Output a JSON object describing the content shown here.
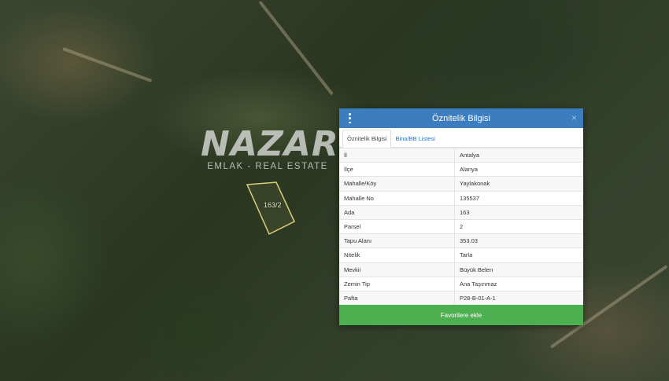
{
  "watermark": {
    "title": "NAZAR",
    "subtitle": "EMLAK - REAL ESTATE"
  },
  "parcel": {
    "label": "163/2"
  },
  "popup": {
    "title": "Öznitelik Bilgisi",
    "tabs": [
      {
        "label": "Öznitelik Bilgisi",
        "active": true
      },
      {
        "label": "Bina/BB Listesi",
        "active": false
      }
    ],
    "rows": [
      {
        "key": "İl",
        "value": "Antalya"
      },
      {
        "key": "İlçe",
        "value": "Alanya"
      },
      {
        "key": "Mahalle/Köy",
        "value": "Yaylakonak"
      },
      {
        "key": "Mahalle No",
        "value": "135537"
      },
      {
        "key": "Ada",
        "value": "163"
      },
      {
        "key": "Parsel",
        "value": "2"
      },
      {
        "key": "Tapu Alanı",
        "value": "353.03"
      },
      {
        "key": "Nitelik",
        "value": "Tarla"
      },
      {
        "key": "Mevkii",
        "value": "Büyük Belen"
      },
      {
        "key": "Zemin Tip",
        "value": "Ana Taşınmaz"
      },
      {
        "key": "Pafta",
        "value": "P28-B-01-A-1"
      }
    ],
    "favorite_label": "Favorilere ekle",
    "close_symbol": "×"
  },
  "colors": {
    "header": "#3b7dbf",
    "button": "#4caf50",
    "parcel_outline": "#d8d07a"
  }
}
